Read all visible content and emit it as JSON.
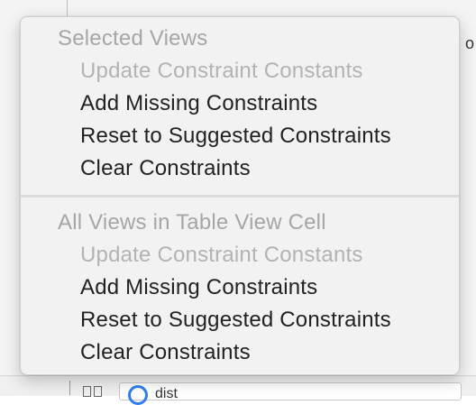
{
  "background": {
    "edge_char": "o",
    "bottom_partial_text": "",
    "bottom_field_text": "dist"
  },
  "menu": {
    "section1": {
      "header": "Selected Views",
      "items": [
        {
          "label": "Update Constraint Constants",
          "enabled": false
        },
        {
          "label": "Add Missing Constraints",
          "enabled": true
        },
        {
          "label": "Reset to Suggested Constraints",
          "enabled": true
        },
        {
          "label": "Clear Constraints",
          "enabled": true
        }
      ]
    },
    "section2": {
      "header": "All Views in Table View Cell",
      "items": [
        {
          "label": "Update Constraint Constants",
          "enabled": false
        },
        {
          "label": "Add Missing Constraints",
          "enabled": true
        },
        {
          "label": "Reset to Suggested Constraints",
          "enabled": true
        },
        {
          "label": "Clear Constraints",
          "enabled": true
        }
      ]
    }
  },
  "colors": {
    "header_text": "#a6a6a6",
    "disabled_text": "#b3b3b3",
    "enabled_text": "#222222",
    "menu_background": "#f2f2f2",
    "accent": "#2f7ef0"
  }
}
